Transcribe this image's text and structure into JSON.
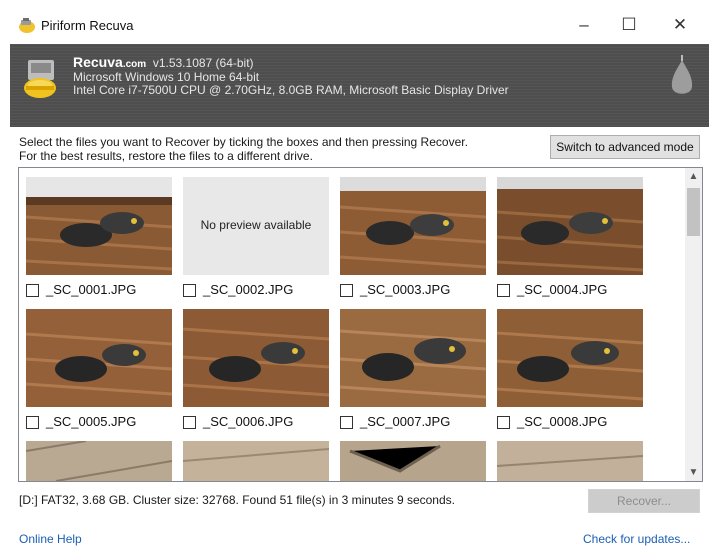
{
  "window": {
    "title": "Piriform Recuva",
    "minimize": "–",
    "maximize": "☐",
    "close": "✕"
  },
  "header": {
    "product": "Recuva",
    "domain": ".com",
    "version": "v1.53.1087 (64-bit)",
    "os": "Microsoft Windows 10 Home 64-bit",
    "hardware": "Intel Core i7-7500U CPU @ 2.70GHz, 8.0GB RAM, Microsoft Basic Display Driver"
  },
  "instructions": {
    "line1": "Select the files you want to Recover by ticking the boxes and then pressing Recover.",
    "line2": "For the best results, restore the files to a different drive."
  },
  "advanced_button": "Switch to advanced mode",
  "files": [
    {
      "name": "_SC_0001.JPG",
      "preview": true
    },
    {
      "name": "_SC_0002.JPG",
      "preview": false,
      "no_preview_text": "No preview available"
    },
    {
      "name": "_SC_0003.JPG",
      "preview": true
    },
    {
      "name": "_SC_0004.JPG",
      "preview": true
    },
    {
      "name": "_SC_0005.JPG",
      "preview": true
    },
    {
      "name": "_SC_0006.JPG",
      "preview": true
    },
    {
      "name": "_SC_0007.JPG",
      "preview": true
    },
    {
      "name": "_SC_0008.JPG",
      "preview": true
    }
  ],
  "status": "[D:] FAT32, 3.68 GB. Cluster size: 32768. Found 51 file(s) in 3 minutes 9 seconds.",
  "recover_button": "Recover...",
  "footer": {
    "help": "Online Help",
    "updates": "Check for updates..."
  },
  "colors": {
    "header_bg": "#4e4e4e",
    "link": "#1a5fb4",
    "wood": "#8a5a34"
  }
}
